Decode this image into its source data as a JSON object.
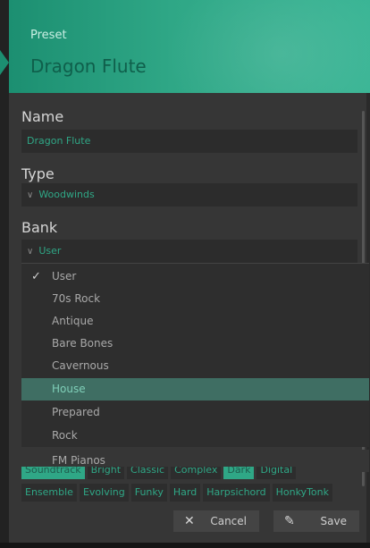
{
  "header": {
    "subtitle": "Preset",
    "title": "Dragon Flute"
  },
  "form": {
    "name_label": "Name",
    "name_value": "Dragon Flute",
    "type_label": "Type",
    "type_value": "Woodwinds",
    "bank_label": "Bank",
    "bank_value": "User"
  },
  "bank_dropdown": {
    "items": [
      {
        "label": "User",
        "checked": true
      },
      {
        "label": "70s Rock"
      },
      {
        "label": "Antique"
      },
      {
        "label": "Bare Bones"
      },
      {
        "label": "Cavernous"
      },
      {
        "label": "House",
        "highlighted": true
      },
      {
        "label": "Prepared"
      },
      {
        "label": "Rock"
      },
      {
        "label": "FM Pianos"
      }
    ]
  },
  "tags": {
    "row_partial": [
      "Soundtrack",
      "Bright",
      "Classic",
      "Complex",
      "Dark",
      "Digital"
    ],
    "row_visible": [
      "Ensemble",
      "Evolving",
      "Funky",
      "Hard",
      "Harpsichord",
      "HonkyTonk"
    ]
  },
  "buttons": {
    "cancel": "Cancel",
    "save": "Save"
  },
  "colors": {
    "accent": "#2fa786",
    "panel": "#363636",
    "highlight": "#3f6e63"
  }
}
